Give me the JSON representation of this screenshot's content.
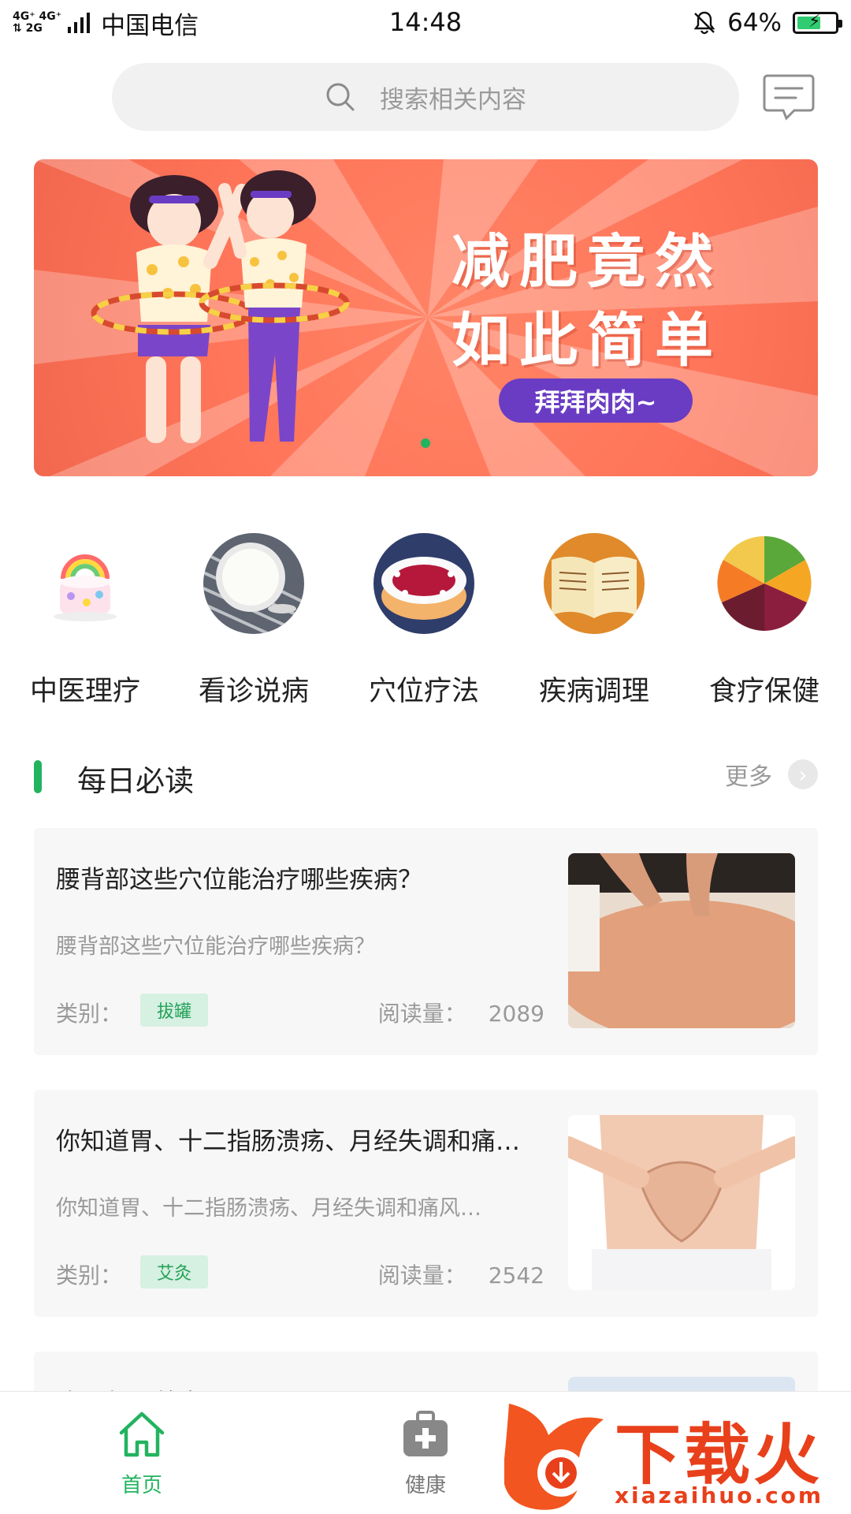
{
  "status_bar": {
    "network_top": "4G⁺ 4G⁺",
    "network_bottom": "⇅ 2G",
    "carrier": "中国电信",
    "time": "14:48",
    "battery_percent": "64%",
    "battery_level": 0.64,
    "icons": [
      "signal-icon",
      "mute-bell-icon",
      "battery-icon"
    ]
  },
  "search": {
    "placeholder": "搜索相关内容",
    "icon": "search-icon"
  },
  "header": {
    "message_icon": "message-icon"
  },
  "banner": {
    "line1": "减肥竟然",
    "line2": "如此简单",
    "pill": "拜拜肉肉~",
    "background_color": "#ff7559",
    "pill_color": "#6a3cc4",
    "active_dot_color": "#22b35f"
  },
  "categories": [
    {
      "label": "中医理疗",
      "image": "rainbow-cake-image"
    },
    {
      "label": "看诊说病",
      "image": "yogurt-bowl-image"
    },
    {
      "label": "穴位疗法",
      "image": "berry-cake-image"
    },
    {
      "label": "疾病调理",
      "image": "book-image"
    },
    {
      "label": "食疗保健",
      "image": "fruit-tart-image"
    }
  ],
  "section": {
    "title": "每日必读",
    "more": "更多",
    "accent_color": "#22b35f"
  },
  "articles": [
    {
      "title": "腰背部这些穴位能治疗哪些疾病？",
      "desc": "腰背部这些穴位能治疗哪些疾病？",
      "category_key": "类别：",
      "category": "拔罐",
      "reads_key": "阅读量：",
      "reads": "2089",
      "image": "back-massage-image"
    },
    {
      "title": "你知道胃、十二指肠溃疡、月经失调和痛…",
      "desc": "你知道胃、十二指肠溃疡、月经失调和痛风…",
      "category_key": "类别：",
      "category": "艾灸",
      "reads_key": "阅读量：",
      "reads": "2542",
      "image": "belly-heart-hands-image"
    },
    {
      "title": "晚间怎么养生？",
      "image": "partial-image"
    }
  ],
  "bottom_nav": {
    "home": "首页",
    "health": "健康"
  },
  "watermark": {
    "text": "下载火",
    "sub": "xiazaihuo.com"
  }
}
